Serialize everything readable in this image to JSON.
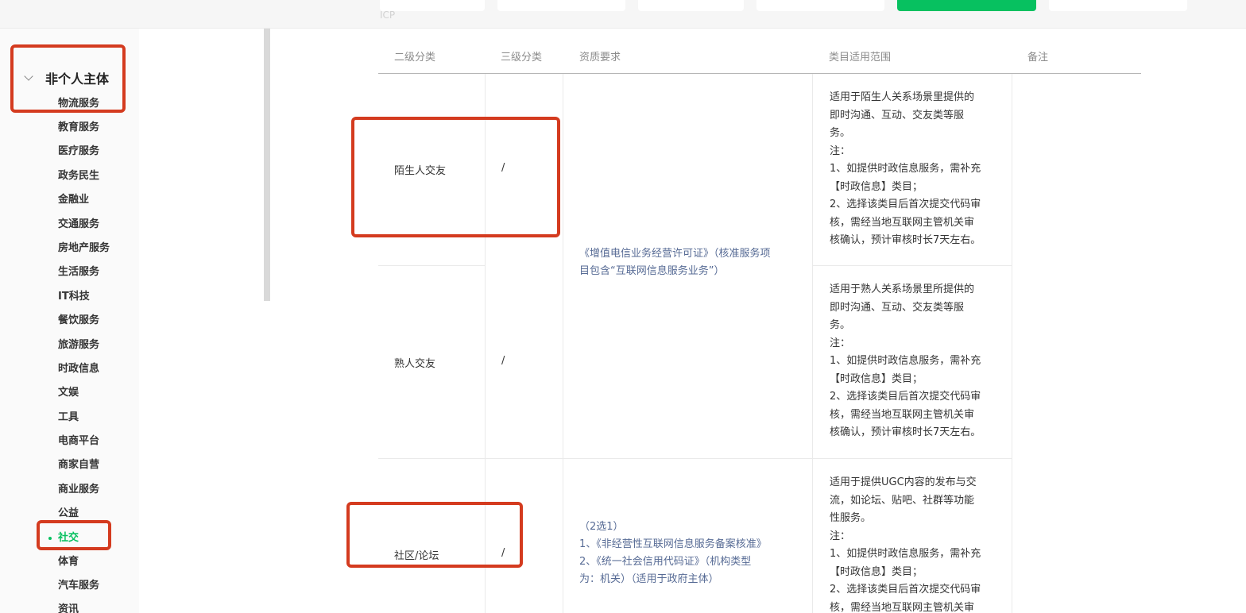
{
  "header_faint_text": "ICP",
  "sidebar": {
    "group_label": "非个人主体",
    "items": [
      {
        "label": "物流服务"
      },
      {
        "label": "教育服务"
      },
      {
        "label": "医疗服务"
      },
      {
        "label": "政务民生"
      },
      {
        "label": "金融业"
      },
      {
        "label": "交通服务"
      },
      {
        "label": "房地产服务"
      },
      {
        "label": "生活服务"
      },
      {
        "label": "IT科技"
      },
      {
        "label": "餐饮服务"
      },
      {
        "label": "旅游服务"
      },
      {
        "label": "时政信息"
      },
      {
        "label": "文娱"
      },
      {
        "label": "工具"
      },
      {
        "label": "电商平台"
      },
      {
        "label": "商家自营"
      },
      {
        "label": "商业服务"
      },
      {
        "label": "公益"
      },
      {
        "label": "社交",
        "active": true
      },
      {
        "label": "体育"
      },
      {
        "label": "汽车服务"
      },
      {
        "label": "资讯"
      }
    ]
  },
  "table": {
    "headers": [
      "二级分类",
      "三级分类",
      "资质要求",
      "类目适用范围",
      "备注"
    ],
    "rows": [
      {
        "level2": "陌生人交友",
        "level3": "/",
        "scope": [
          "适用于陌生人关系场景里提供的",
          "即时沟通、互动、交友类等服",
          "务。",
          "注：",
          "1、如提供时政信息服务，需补充",
          "【时政信息】类目；",
          "2、选择该类目后首次提交代码审",
          "核，需经当地互联网主管机关审",
          "核确认，预计审核时长7天左右。"
        ]
      },
      {
        "level2": "熟人交友",
        "level3": "/",
        "scope": [
          "适用于熟人关系场景里所提供的",
          "即时沟通、互动、交友类等服",
          "务。",
          "注：",
          "1、如提供时政信息服务，需补充",
          "【时政信息】类目；",
          "2、选择该类目后首次提交代码审",
          "核，需经当地互联网主管机关审",
          "核确认，预计审核时长7天左右。"
        ]
      },
      {
        "level2": "社区/论坛",
        "level3": "/",
        "scope": [
          "适用于提供UGC内容的发布与交",
          "流，如论坛、贴吧、社群等功能",
          "性服务。",
          "注：",
          "1、如提供时政信息服务，需补充",
          "【时政信息】类目；",
          "2、选择该类目后首次提交代码审",
          "核，需经当地互联网主管机关审"
        ]
      }
    ],
    "shared_requirement": [
      "《增值电信业务经营许可证》（核准服务项",
      "目包含“互联网信息服务业务”）"
    ],
    "forum_requirement": [
      "（2选1）",
      "1、《非经营性互联网信息服务备案核准》",
      "2、《统一社会信用代码证》（机构类型",
      "为：机关）（适用于政府主体）"
    ]
  },
  "colors": {
    "accent": "#07c160",
    "link": "#576b95",
    "annotation": "#d43b1f"
  }
}
